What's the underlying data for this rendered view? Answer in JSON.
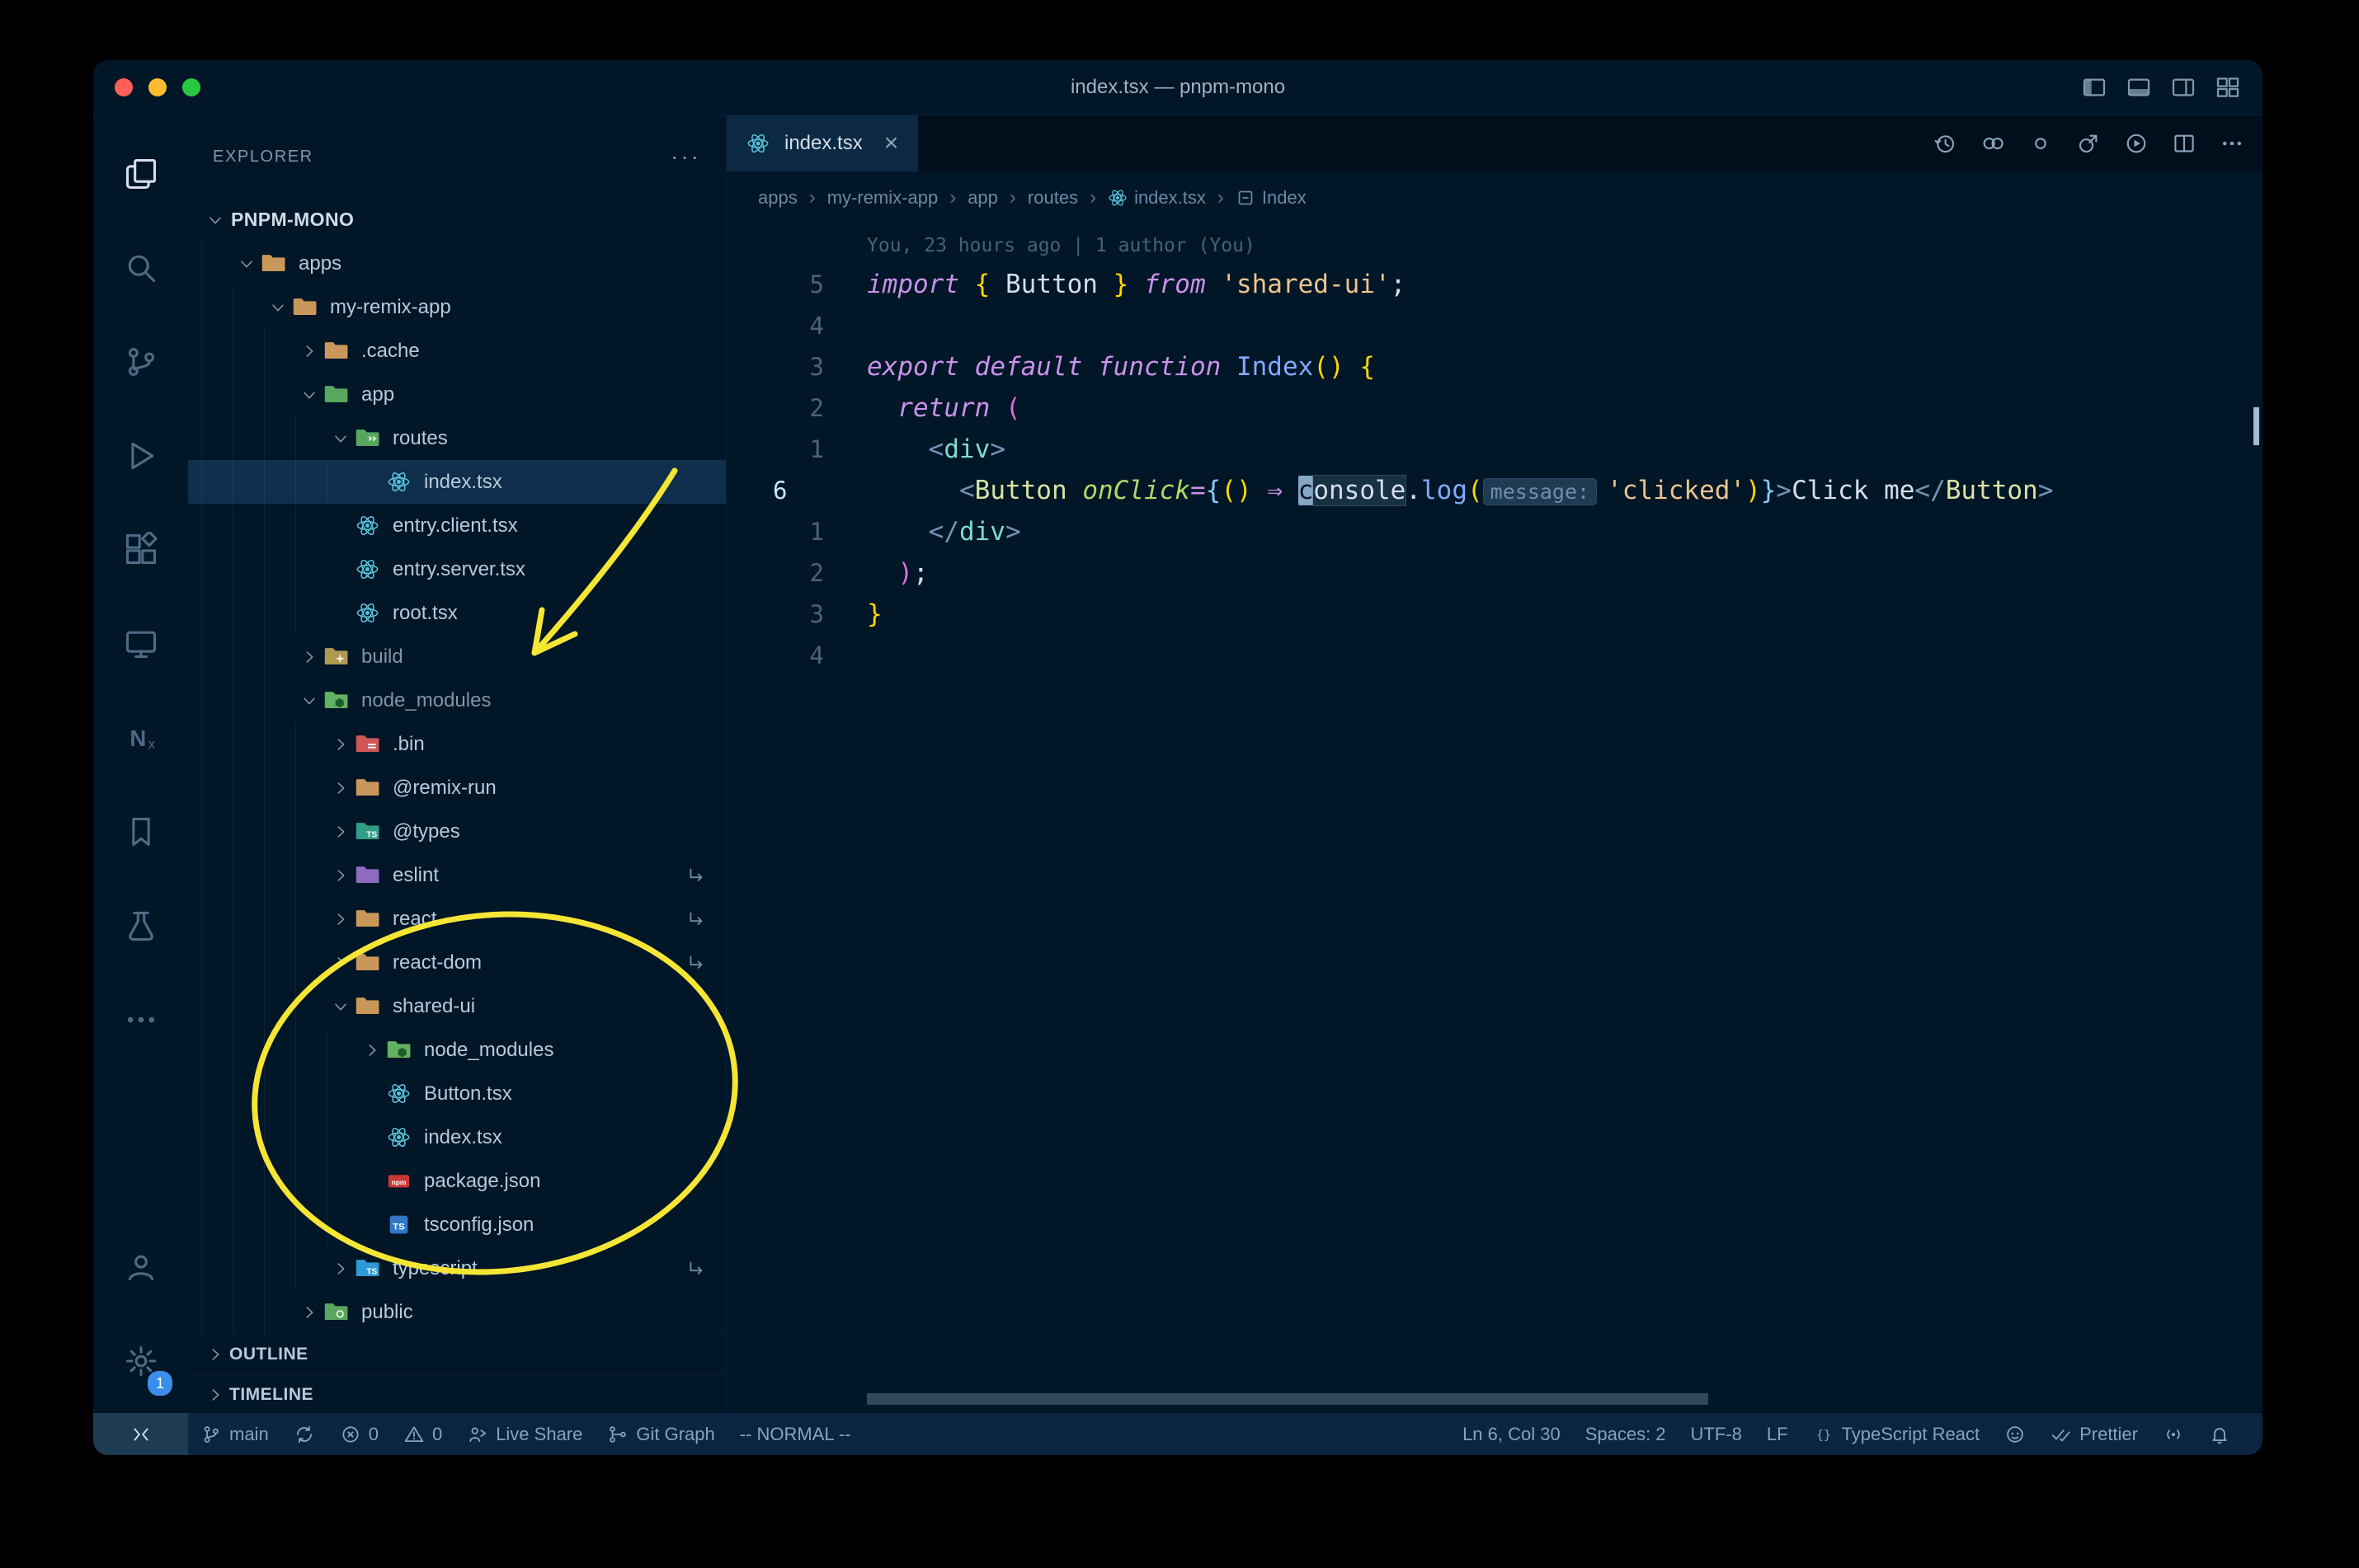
{
  "window": {
    "title": "index.tsx — pnpm-mono",
    "traffic_lights": [
      "close",
      "minimize",
      "zoom"
    ],
    "layout_icons": [
      "layout-sidebar-left",
      "layout-panel-bottom",
      "layout-sidebar-right",
      "layout-grid"
    ]
  },
  "activity_bar": {
    "items": [
      {
        "name": "explorer",
        "active": true
      },
      {
        "name": "search"
      },
      {
        "name": "source-control"
      },
      {
        "name": "run-debug"
      },
      {
        "name": "extensions"
      },
      {
        "name": "remote-explorer"
      },
      {
        "name": "nx-console"
      },
      {
        "name": "bookmarks"
      },
      {
        "name": "test-explorer"
      },
      {
        "name": "more-views"
      }
    ],
    "bottom": [
      {
        "name": "account"
      },
      {
        "name": "settings",
        "badge": "1"
      }
    ]
  },
  "sidebar": {
    "header": {
      "title": "EXPLORER",
      "actions": "···"
    },
    "tree": [
      {
        "label": "PNPM-MONO",
        "level": 0,
        "chevron": "down",
        "icon": null,
        "bold": true
      },
      {
        "label": "apps",
        "level": 1,
        "chevron": "down",
        "icon": "folder-tan"
      },
      {
        "label": "my-remix-app",
        "level": 2,
        "chevron": "down",
        "icon": "folder-tan"
      },
      {
        "label": ".cache",
        "level": 3,
        "chevron": "right",
        "icon": "folder-tan"
      },
      {
        "label": "app",
        "level": 3,
        "chevron": "down",
        "icon": "folder-green"
      },
      {
        "label": "routes",
        "level": 4,
        "chevron": "down",
        "icon": "folder-routes"
      },
      {
        "label": "index.tsx",
        "level": 5,
        "chevron": null,
        "icon": "react",
        "selected": true
      },
      {
        "label": "entry.client.tsx",
        "level": 4,
        "chevron": null,
        "icon": "react"
      },
      {
        "label": "entry.server.tsx",
        "level": 4,
        "chevron": null,
        "icon": "react"
      },
      {
        "label": "root.tsx",
        "level": 4,
        "chevron": null,
        "icon": "react"
      },
      {
        "label": "build",
        "level": 3,
        "chevron": "right",
        "icon": "folder-build",
        "dim": true
      },
      {
        "label": "node_modules",
        "level": 3,
        "chevron": "down",
        "icon": "folder-node",
        "dim": true
      },
      {
        "label": ".bin",
        "level": 4,
        "chevron": "right",
        "icon": "folder-bin"
      },
      {
        "label": "@remix-run",
        "level": 4,
        "chevron": "right",
        "icon": "folder-tan"
      },
      {
        "label": "@types",
        "level": 4,
        "chevron": "right",
        "icon": "folder-types"
      },
      {
        "label": "eslint",
        "level": 4,
        "chevron": "right",
        "icon": "folder-purple",
        "symlink": true
      },
      {
        "label": "react",
        "level": 4,
        "chevron": "right",
        "icon": "folder-tan",
        "symlink": true
      },
      {
        "label": "react-dom",
        "level": 4,
        "chevron": "right",
        "icon": "folder-tan",
        "symlink": true
      },
      {
        "label": "shared-ui",
        "level": 4,
        "chevron": "down",
        "icon": "folder-tan"
      },
      {
        "label": "node_modules",
        "level": 5,
        "chevron": "right",
        "icon": "folder-node"
      },
      {
        "label": "Button.tsx",
        "level": 5,
        "chevron": null,
        "icon": "react"
      },
      {
        "label": "index.tsx",
        "level": 5,
        "chevron": null,
        "icon": "react"
      },
      {
        "label": "package.json",
        "level": 5,
        "chevron": null,
        "icon": "npm"
      },
      {
        "label": "tsconfig.json",
        "level": 5,
        "chevron": null,
        "icon": "ts"
      },
      {
        "label": "typescript",
        "level": 4,
        "chevron": "right",
        "icon": "folder-blue",
        "symlink": true
      },
      {
        "label": "public",
        "level": 3,
        "chevron": "right",
        "icon": "folder-public"
      }
    ],
    "sections": [
      {
        "label": "OUTLINE"
      },
      {
        "label": "TIMELINE"
      }
    ]
  },
  "editor": {
    "tab": {
      "label": "index.tsx",
      "icon": "react",
      "close": "×"
    },
    "actions": [
      "timeline",
      "open-changes",
      "outline",
      "preview",
      "run-code",
      "split-editor",
      "more-actions"
    ],
    "breadcrumbs": [
      {
        "label": "apps"
      },
      {
        "label": "my-remix-app"
      },
      {
        "label": "app"
      },
      {
        "label": "routes"
      },
      {
        "label": "index.tsx",
        "icon": "react"
      },
      {
        "label": "Index",
        "icon": "symbol-module"
      }
    ],
    "blame": "You, 23 hours ago | 1 author (You)",
    "code": {
      "current_line": "6",
      "cursor": "Ln 6, Col 30",
      "lines": [
        {
          "num": "5",
          "tokens": [
            [
              "import",
              "kw"
            ],
            [
              " ",
              "pl"
            ],
            [
              "{",
              "b1"
            ],
            [
              " Button ",
              "pl"
            ],
            [
              "}",
              "b1"
            ],
            [
              " ",
              "pl"
            ],
            [
              "from",
              "kw"
            ],
            [
              " ",
              "pl"
            ],
            [
              "'shared-ui'",
              "str"
            ],
            [
              ";",
              "pl"
            ]
          ]
        },
        {
          "num": "4",
          "tokens": []
        },
        {
          "num": "3",
          "tokens": [
            [
              "export",
              "kw"
            ],
            [
              " ",
              "pl"
            ],
            [
              "default",
              "kw"
            ],
            [
              " ",
              "pl"
            ],
            [
              "function",
              "kw"
            ],
            [
              " ",
              "pl"
            ],
            [
              "Index",
              "fn"
            ],
            [
              "(",
              "b1"
            ],
            [
              ")",
              "b1"
            ],
            [
              " ",
              "pl"
            ],
            [
              "{",
              "b1"
            ]
          ]
        },
        {
          "num": "2",
          "tokens": [
            [
              "  ",
              "pl"
            ],
            [
              "return",
              "kw"
            ],
            [
              " ",
              "pl"
            ],
            [
              "(",
              "b2"
            ]
          ]
        },
        {
          "num": "1",
          "tokens": [
            [
              "    ",
              "pl"
            ],
            [
              "<",
              "pt"
            ],
            [
              "div",
              "tag"
            ],
            [
              ">",
              "pt"
            ]
          ]
        },
        {
          "num": "6",
          "current": true,
          "tokens": [
            [
              "      ",
              "pl"
            ],
            [
              "<",
              "pt"
            ],
            [
              "Button",
              "comp"
            ],
            [
              " ",
              "pl"
            ],
            [
              "onClick",
              "attr"
            ],
            [
              "=",
              "op"
            ],
            [
              "{",
              "b3"
            ],
            [
              "(",
              "b1"
            ],
            [
              ")",
              "b1"
            ],
            [
              " ",
              "pl"
            ],
            [
              "⇒",
              "op"
            ],
            [
              " ",
              "pl"
            ],
            [
              "c",
              "cur"
            ],
            [
              "onsole",
              "hl"
            ],
            [
              ".",
              "pl"
            ],
            [
              "log",
              "fn"
            ],
            [
              "(",
              "b1"
            ],
            [
              "message:",
              "inlay"
            ],
            [
              "'clicked'",
              "str"
            ],
            [
              ")",
              "b1"
            ],
            [
              "}",
              "b3"
            ],
            [
              ">",
              "pt"
            ],
            [
              "Click me",
              "pl"
            ],
            [
              "</",
              "pt"
            ],
            [
              "Button",
              "comp"
            ],
            [
              ">",
              "pt"
            ]
          ]
        },
        {
          "num": "1",
          "tokens": [
            [
              "    ",
              "pl"
            ],
            [
              "</",
              "pt"
            ],
            [
              "div",
              "tag"
            ],
            [
              ">",
              "pt"
            ]
          ]
        },
        {
          "num": "2",
          "tokens": [
            [
              "  ",
              "pl"
            ],
            [
              ")",
              "b2"
            ],
            [
              ";",
              "pl"
            ]
          ]
        },
        {
          "num": "3",
          "tokens": [
            [
              "}",
              "b1"
            ]
          ]
        },
        {
          "num": "4",
          "tokens": []
        }
      ]
    }
  },
  "status_bar": {
    "left": [
      {
        "icon": "remote",
        "name": "remote-indicator",
        "remote": true
      },
      {
        "icon": "git-branch",
        "label": "main",
        "name": "branch"
      },
      {
        "icon": "sync",
        "name": "sync"
      },
      {
        "icon": "error",
        "label": "0",
        "name": "errors"
      },
      {
        "icon": "warning",
        "label": "0",
        "name": "warnings"
      },
      {
        "icon": "live-share",
        "label": "Live Share",
        "name": "live-share"
      },
      {
        "icon": "git-graph",
        "label": "Git Graph",
        "name": "git-graph"
      },
      {
        "label": "-- NORMAL --",
        "name": "vim-mode"
      }
    ],
    "right": [
      {
        "label": "Ln 6, Col 30",
        "name": "cursor-position"
      },
      {
        "label": "Spaces: 2",
        "name": "indentation"
      },
      {
        "label": "UTF-8",
        "name": "encoding"
      },
      {
        "label": "LF",
        "name": "eol"
      },
      {
        "icon": "braces",
        "label": "TypeScript React",
        "name": "language-mode"
      },
      {
        "icon": "copilot",
        "name": "copilot"
      },
      {
        "icon": "double-check",
        "label": "Prettier",
        "name": "formatter"
      },
      {
        "icon": "broadcast",
        "name": "screen-reader"
      },
      {
        "icon": "bell",
        "name": "notifications"
      }
    ]
  },
  "annotations": {
    "color": "#f5e636",
    "shapes": [
      "arrow-to-node-modules",
      "ellipse-around-shared-ui"
    ]
  },
  "colors": {
    "folder_tan": "#c9975a",
    "folder_green": "#59a75f",
    "folder_node": "#62b162",
    "folder_build": "#b09a52",
    "folder_bin": "#d15757",
    "folder_types": "#2f9e86",
    "folder_purple": "#8e6bbf",
    "folder_blue": "#2f9ad6",
    "folder_public": "#59a75f",
    "react_blue": "#58c4dc",
    "npm_red": "#cb3837",
    "ts_blue": "#3178c6",
    "badge_blue": "#3b8eea"
  }
}
